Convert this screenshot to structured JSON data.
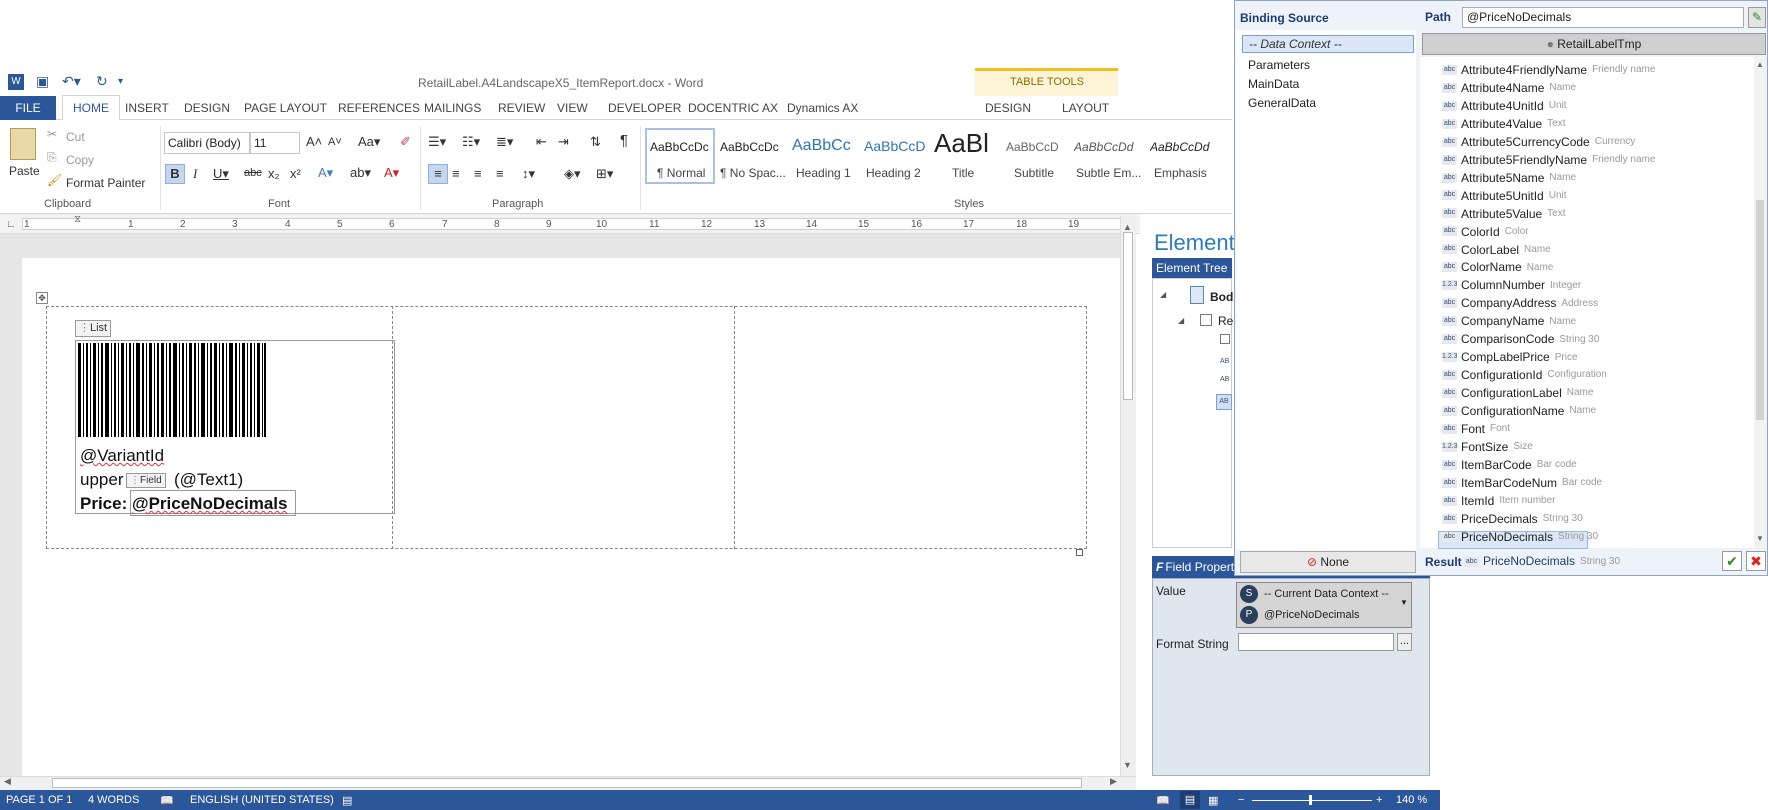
{
  "word": {
    "doc_title": "RetailLabel.A4LandscapeX5_ItemReport.docx - Word",
    "tabs": [
      "INSERT",
      "DESIGN",
      "PAGE LAYOUT",
      "REFERENCES",
      "MAILINGS",
      "REVIEW",
      "VIEW",
      "DEVELOPER",
      "DOCENTRIC AX",
      "Dynamics AX",
      "DESIGN",
      "LAYOUT"
    ],
    "file_tab": "FILE",
    "home_tab": "HOME",
    "table_tools": "TABLE TOOLS",
    "clipboard": {
      "paste": "Paste",
      "cut": "Cut",
      "copy": "Copy",
      "format_painter": "Format Painter",
      "group": "Clipboard"
    },
    "font": {
      "name": "Calibri (Body)",
      "size": "11",
      "group": "Font"
    },
    "paragraph_group": "Paragraph",
    "styles_group": "Styles",
    "styles": [
      {
        "preview": "AaBbCcDc",
        "name": "¶ Normal"
      },
      {
        "preview": "AaBbCcDc",
        "name": "¶ No Spac..."
      },
      {
        "preview": "AaBbCc",
        "name": "Heading 1"
      },
      {
        "preview": "AaBbCcD",
        "name": "Heading 2"
      },
      {
        "preview": "AaBl",
        "name": "Title"
      },
      {
        "preview": "AaBbCcD",
        "name": "Subtitle"
      },
      {
        "preview": "AaBbCcDd",
        "name": "Subtle Em..."
      },
      {
        "preview": "AaBbCcDd",
        "name": "Emphasis"
      }
    ],
    "ruler_numbers": [
      "1",
      "1",
      "2",
      "3",
      "4",
      "5",
      "6",
      "7",
      "8",
      "9",
      "10",
      "11",
      "12",
      "13",
      "14",
      "15",
      "16",
      "17",
      "18",
      "19"
    ],
    "doc": {
      "list_tag": "List",
      "field_tag": "Field",
      "variant": "@VariantId",
      "upper_prefix": "upper",
      "upper_suffix": "(@Text1)",
      "price_label": "Price:",
      "price_value": "@PriceNoDecimals"
    },
    "element_panel": {
      "title": "Element",
      "tree_head": "Element Tree",
      "body_label": "Bod",
      "re_label": "Re"
    },
    "field_props": {
      "head": "Field Properti",
      "value_label": "Value",
      "value_line1": "-- Current Data Context --",
      "value_line2": "@PriceNoDecimals",
      "format_label": "Format String",
      "browse": "..."
    },
    "status": {
      "page": "PAGE 1 OF 1",
      "words": "4 WORDS",
      "language": "ENGLISH (UNITED STATES)",
      "zoom": "140 %"
    }
  },
  "binding": {
    "source_head": "Binding Source",
    "data_context": "-- Data Context --",
    "sources": [
      "Parameters",
      "MainData",
      "GeneralData"
    ],
    "none_btn": "None",
    "path_label": "Path",
    "path_value": "@PriceNoDecimals",
    "root": "RetailLabelTmp",
    "result_label": "Result",
    "result_icon": "abc",
    "result_value": "PriceNoDecimals",
    "result_type": "String 30",
    "fields": [
      {
        "icon": "abc",
        "name": "Attribute4FriendlyName",
        "type": "Friendly name"
      },
      {
        "icon": "abc",
        "name": "Attribute4Name",
        "type": "Name"
      },
      {
        "icon": "abc",
        "name": "Attribute4UnitId",
        "type": "Unit"
      },
      {
        "icon": "abc",
        "name": "Attribute4Value",
        "type": "Text"
      },
      {
        "icon": "abc",
        "name": "Attribute5CurrencyCode",
        "type": "Currency"
      },
      {
        "icon": "abc",
        "name": "Attribute5FriendlyName",
        "type": "Friendly name"
      },
      {
        "icon": "abc",
        "name": "Attribute5Name",
        "type": "Name"
      },
      {
        "icon": "abc",
        "name": "Attribute5UnitId",
        "type": "Unit"
      },
      {
        "icon": "abc",
        "name": "Attribute5Value",
        "type": "Text"
      },
      {
        "icon": "abc",
        "name": "ColorId",
        "type": "Color"
      },
      {
        "icon": "abc",
        "name": "ColorLabel",
        "type": "Name"
      },
      {
        "icon": "abc",
        "name": "ColorName",
        "type": "Name"
      },
      {
        "icon": "1.2.3",
        "name": "ColumnNumber",
        "type": "Integer"
      },
      {
        "icon": "abc",
        "name": "CompanyAddress",
        "type": "Address"
      },
      {
        "icon": "abc",
        "name": "CompanyName",
        "type": "Name"
      },
      {
        "icon": "abc",
        "name": "ComparisonCode",
        "type": "String 30"
      },
      {
        "icon": "1.2.3",
        "name": "CompLabelPrice",
        "type": "Price"
      },
      {
        "icon": "abc",
        "name": "ConfigurationId",
        "type": "Configuration"
      },
      {
        "icon": "abc",
        "name": "ConfigurationLabel",
        "type": "Name"
      },
      {
        "icon": "abc",
        "name": "ConfigurationName",
        "type": "Name"
      },
      {
        "icon": "abc",
        "name": "Font",
        "type": "Font"
      },
      {
        "icon": "1.2.3",
        "name": "FontSize",
        "type": "Size"
      },
      {
        "icon": "abc",
        "name": "ItemBarCode",
        "type": "Bar code"
      },
      {
        "icon": "abc",
        "name": "ItemBarCodeNum",
        "type": "Bar code"
      },
      {
        "icon": "abc",
        "name": "ItemId",
        "type": "Item number"
      },
      {
        "icon": "abc",
        "name": "PriceDecimals",
        "type": "String 30"
      },
      {
        "icon": "abc",
        "name": "PriceNoDecimals",
        "type": "String 30"
      }
    ]
  }
}
